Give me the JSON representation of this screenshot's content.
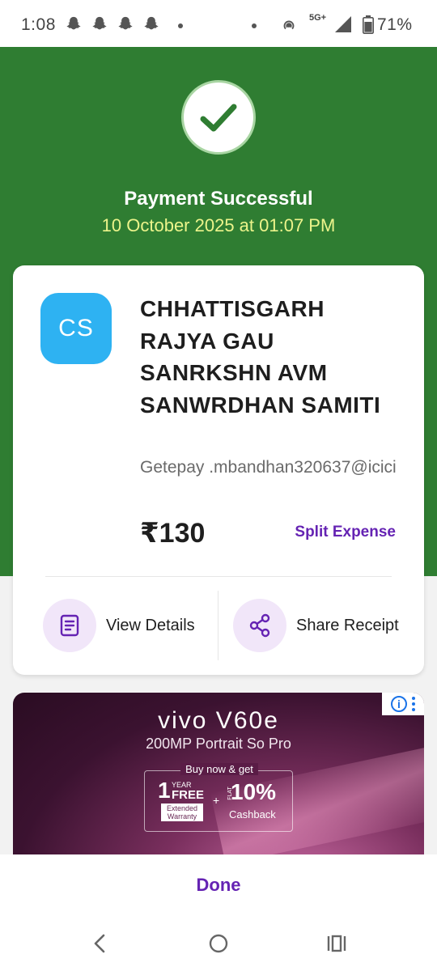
{
  "status_bar": {
    "time": "1:08",
    "network": "5G+",
    "battery": "71%"
  },
  "header": {
    "title": "Payment Successful",
    "datetime": "10 October 2025 at 01:07 PM",
    "colors": {
      "background": "#2f7d32",
      "date": "#ecf48b"
    }
  },
  "payee": {
    "initials": "CS",
    "name": "CHHATTISGARH RAJYA GAU SANRKSHN AVM SANWRDHAN SAMITI",
    "vpa": "Getepay .mbandhan320637@icici",
    "amount": "₹130",
    "split_label": "Split Expense"
  },
  "actions": {
    "view_details": "View Details",
    "share_receipt": "Share Receipt"
  },
  "ad": {
    "brand": "vivo V60e",
    "tagline": "200MP Portrait So Pro",
    "buy_now": "Buy now & get",
    "year_num": "1",
    "year": "YEAR",
    "free": "FREE",
    "warranty": "Extended Warranty",
    "plus": "+",
    "flat": "FLAT",
    "cashback_pct": "10%",
    "cashback": "Cashback"
  },
  "footer": {
    "done_label": "Done"
  },
  "colors": {
    "accent": "#6523b3",
    "avatar": "#2eb2f2"
  }
}
